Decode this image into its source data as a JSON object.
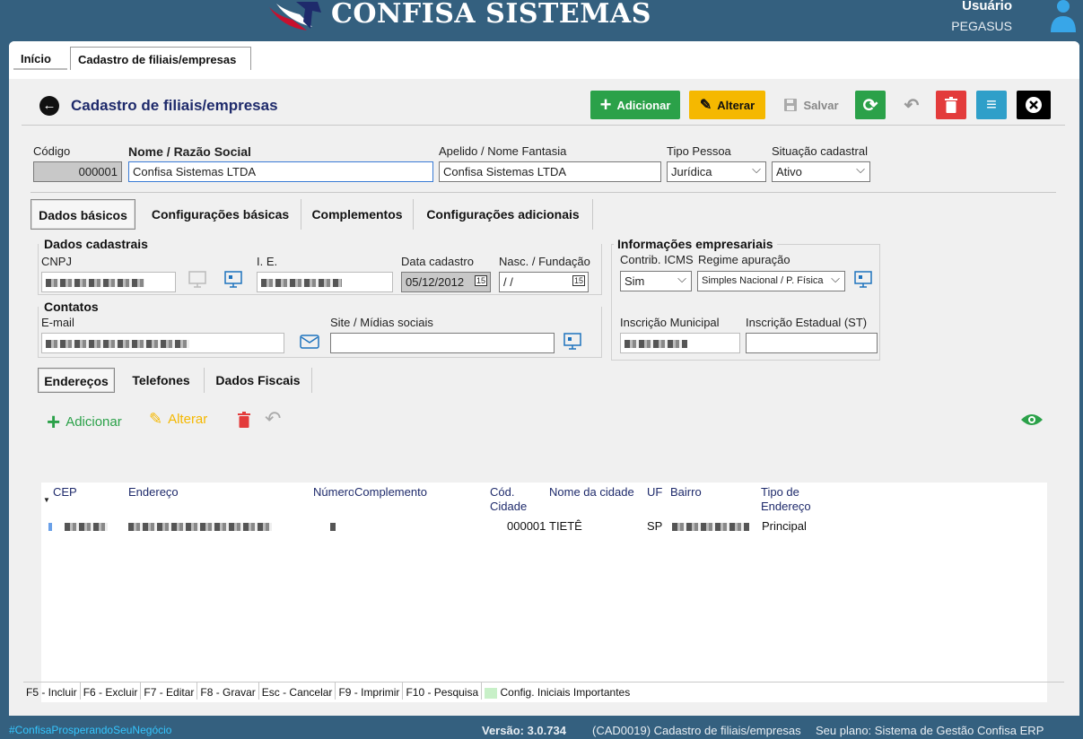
{
  "app": {
    "brand": "CONFISA SISTEMAS",
    "user_label": "Usuário",
    "user_name": "PEGASUS"
  },
  "top_tabs": [
    "Início",
    "Cadastro de filiais/empresas"
  ],
  "header": {
    "title": "Cadastro de filiais/empresas",
    "buttons": {
      "add": "Adicionar",
      "edit": "Alterar",
      "save": "Salvar"
    }
  },
  "form": {
    "codigo_label": "Código",
    "codigo_value": "000001",
    "nome_label": "Nome / Razão Social",
    "nome_value": "Confisa Sistemas LTDA",
    "apelido_label": "Apelido / Nome Fantasia",
    "apelido_value": "Confisa Sistemas LTDA",
    "tipo_label": "Tipo Pessoa",
    "tipo_value": "Jurídica",
    "situacao_label": "Situação cadastral",
    "situacao_value": "Ativo"
  },
  "tabs": [
    "Dados básicos",
    "Configurações básicas",
    "Complementos",
    "Configurações adicionais"
  ],
  "dados_cadastrais": {
    "title": "Dados cadastrais",
    "cnpj_label": "CNPJ",
    "ie_label": "I. E.",
    "data_label": "Data cadastro",
    "data_value": "05/12/2012",
    "nasc_label": "Nasc. / Fundação",
    "nasc_value": " / /"
  },
  "contatos": {
    "title": "Contatos",
    "email_label": "E-mail",
    "site_label": "Site / Mídias sociais"
  },
  "info_empresariais": {
    "title": "Informações empresariais",
    "icms_label": "Contrib. ICMS",
    "icms_value": "Sim",
    "regime_label": "Regime apuração",
    "regime_value": "Simples Nacional / P. Física",
    "im_label": "Inscrição Municipal",
    "ie_st_label": "Inscrição Estadual (ST)"
  },
  "sub_tabs": [
    "Endereços",
    "Telefones",
    "Dados Fiscais"
  ],
  "sub_actions": {
    "add": "Adicionar",
    "edit": "Alterar"
  },
  "grid": {
    "headers": {
      "cep": "CEP",
      "endereco": "Endereço",
      "numero": "Número",
      "complemento": "Complemento",
      "cod_cidade_1": "Cód.",
      "cod_cidade_2": "Cidade",
      "cidade": "Nome da cidade",
      "uf": "UF",
      "bairro": "Bairro",
      "tipo_1": "Tipo de",
      "tipo_2": "Endereço"
    },
    "row": {
      "cod_cidade": "000001",
      "cidade": "TIETÊ",
      "uf": "SP",
      "tipo": "Principal"
    }
  },
  "fkeys": [
    "F5 - Incluir",
    "F6 - Excluir",
    "F7 - Editar",
    "F8 - Gravar",
    "Esc - Cancelar",
    "F9 - Imprimir",
    "F10 - Pesquisa",
    "Config. Iniciais Importantes"
  ],
  "status": {
    "hashtag": "#ConfisaProsperandoSeuNegócio",
    "versao": "Versão: 3.0.734",
    "modulo": "(CAD0019) Cadastro de filiais/empresas",
    "plano": "Seu plano: Sistema de Gestão Confisa ERP Modular"
  },
  "colors": {
    "green": "#2ba149",
    "yellow": "#f5b800",
    "red": "#e33b3b",
    "blue": "#2f9fc9",
    "navy": "#1e2a6b"
  }
}
